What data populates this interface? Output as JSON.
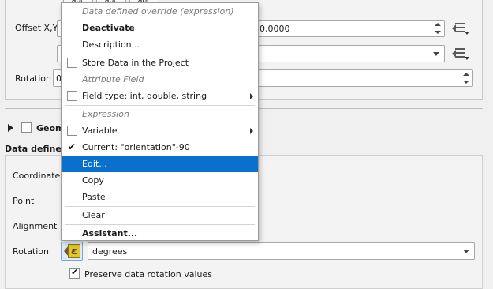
{
  "top": {
    "partial_buttons": [
      "abc",
      "abc",
      "abc"
    ],
    "offset_label": "Offset X,Y",
    "offset_value": "0,0000",
    "rotation_label": "Rotation",
    "rotation_value": "0"
  },
  "geometry_group": {
    "label": "Geom"
  },
  "data_defined": {
    "title": "Data defined",
    "coordinate_label": "Coordinate",
    "point_label": "Point",
    "alignment_label": "Alignment",
    "rotation_label": "Rotation",
    "rotation_unit": "degrees",
    "preserve_label": "Preserve data rotation values",
    "preserve_checked": true
  },
  "context_menu": {
    "header_override": "Data defined override (expression)",
    "deactivate": "Deactivate",
    "description": "Description...",
    "store_data": "Store Data in the Project",
    "attribute_field_header": "Attribute Field",
    "field_type": "Field type: int, double, string",
    "expression_header": "Expression",
    "variable": "Variable",
    "current": "Current: \"orientation\"-90",
    "current_checked": true,
    "edit": "Edit...",
    "copy": "Copy",
    "paste": "Paste",
    "clear": "Clear",
    "assistant": "Assistant..."
  },
  "colors": {
    "highlight": "#0b6fce",
    "expression_icon": "#e3c42e"
  },
  "icons": [
    "data-defined-override-icon",
    "expression-epsilon-icon",
    "expand-arrow-icon",
    "submenu-arrow-icon"
  ]
}
